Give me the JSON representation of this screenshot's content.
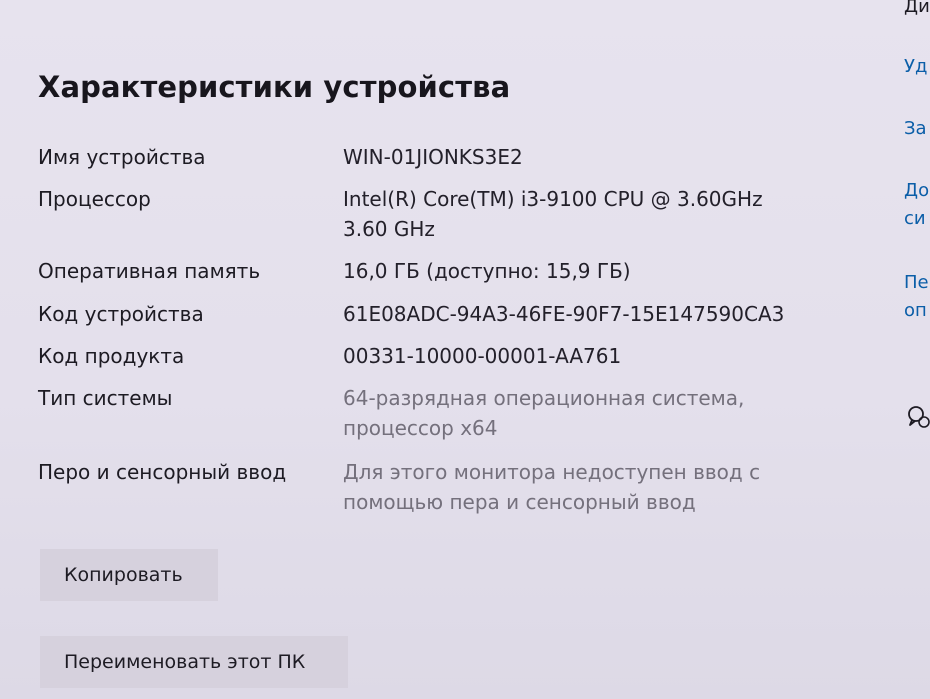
{
  "section": {
    "title": "Характеристики устройства"
  },
  "specs": [
    {
      "label": "Имя устройства",
      "value": "WIN-01JIONKS3E2"
    },
    {
      "label": "Процессор",
      "value": "Intel(R) Core(TM) i3-9100 CPU @ 3.60GHz",
      "value2": "3.60 GHz"
    },
    {
      "label": "Оперативная память",
      "value": "16,0 ГБ (доступно: 15,9 ГБ)"
    },
    {
      "label": "Код устройства",
      "value": "61E08ADC-94A3-46FE-90F7-15E147590CA3"
    },
    {
      "label": "Код продукта",
      "value": "00331-10000-00001-AA761"
    },
    {
      "label": "Тип системы",
      "value": "64-разрядная операционная система,",
      "value2": "процессор x64"
    },
    {
      "label": "Перо и сенсорный ввод",
      "value": "Для этого монитора недоступен ввод с",
      "value2": "помощью пера и сенсорный ввод"
    }
  ],
  "buttons": {
    "copy": "Копировать",
    "rename": "Переименовать этот ПК"
  },
  "right_column": {
    "items": [
      "Ди",
      "Уд",
      "За",
      "До",
      "си",
      "Пе",
      "оп"
    ]
  },
  "icons": {
    "feedback": "feedback-icon"
  },
  "colors": {
    "background": "#e5e1ed",
    "button": "#d6d1dd",
    "link": "#0b5ea8",
    "muted_text": "#74707c"
  }
}
